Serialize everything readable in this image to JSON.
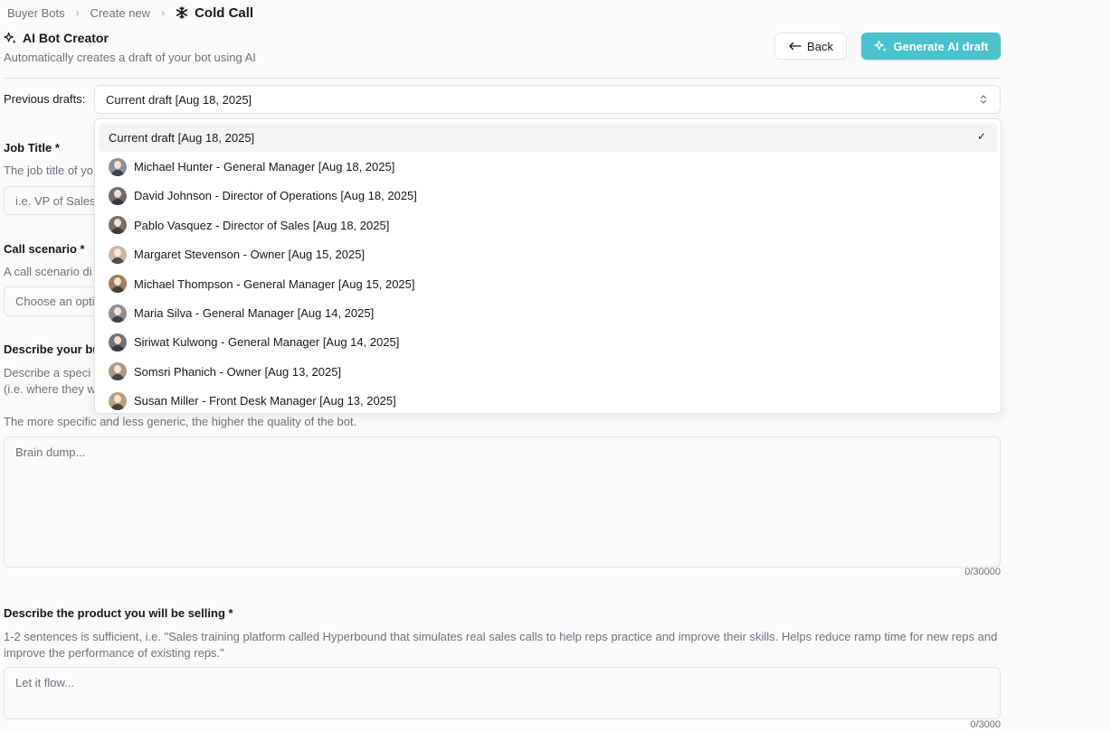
{
  "breadcrumb": {
    "item1": "Buyer Bots",
    "item2": "Create new",
    "current": "Cold Call"
  },
  "header": {
    "title": "AI Bot Creator",
    "subtitle": "Automatically creates a draft of your bot using AI",
    "back_label": "Back",
    "generate_label": "Generate AI draft"
  },
  "drafts": {
    "label": "Previous drafts:",
    "selected": "Current draft  [Aug 18, 2025]",
    "options": [
      {
        "label": "Current draft  [Aug 18, 2025]",
        "selected": true
      },
      {
        "label": "Michael Hunter  -  General Manager  [Aug 18, 2025]",
        "avatar_color": "#8a8f98"
      },
      {
        "label": "David Johnson  -  Director of Operations  [Aug 18, 2025]",
        "avatar_color": "#6b6f75"
      },
      {
        "label": "Pablo Vasquez  -  Director of Sales  [Aug 18, 2025]",
        "avatar_color": "#7a6f66"
      },
      {
        "label": "Margaret Stevenson  -  Owner  [Aug 15, 2025]",
        "avatar_color": "#c9b6a8"
      },
      {
        "label": "Michael Thompson  -  General Manager  [Aug 15, 2025]",
        "avatar_color": "#9c7f5e"
      },
      {
        "label": "Maria Silva  -  General Manager  [Aug 14, 2025]",
        "avatar_color": "#8d8d92"
      },
      {
        "label": "Siriwat Kulwong  -  General Manager  [Aug 14, 2025]",
        "avatar_color": "#70747a"
      },
      {
        "label": "Somsri Phanich  -  Owner  [Aug 13, 2025]",
        "avatar_color": "#a59a8c"
      },
      {
        "label": "Susan Miller  -  Front Desk Manager  [Aug 13, 2025]",
        "avatar_color": "#b89e7e"
      }
    ]
  },
  "job_title": {
    "label": "Job Title *",
    "help": "The job title of yo",
    "placeholder": "i.e. VP of Sales"
  },
  "call_scenario": {
    "label": "Call scenario *",
    "help": "A call scenario di",
    "placeholder": "Choose an opti"
  },
  "buyer": {
    "label": "Describe your bu",
    "help_line1": "Describe a speci",
    "help_line2": "(i.e. where they w",
    "hint": "The more specific and less generic, the higher the quality of the bot.",
    "placeholder": "Brain dump...",
    "counter": "0/30000"
  },
  "product": {
    "label": "Describe the product you will be selling *",
    "help": "1-2 sentences is sufficient, i.e. \"Sales training platform called Hyperbound that simulates real sales calls to help reps practice and improve their skills. Helps reduce ramp time for new reps and improve the performance of existing reps.\"",
    "placeholder": "Let it flow...",
    "counter": "0/3000"
  },
  "colors": {
    "accent": "#48c3cb",
    "border": "#e4e4e7",
    "muted": "#71717a"
  }
}
